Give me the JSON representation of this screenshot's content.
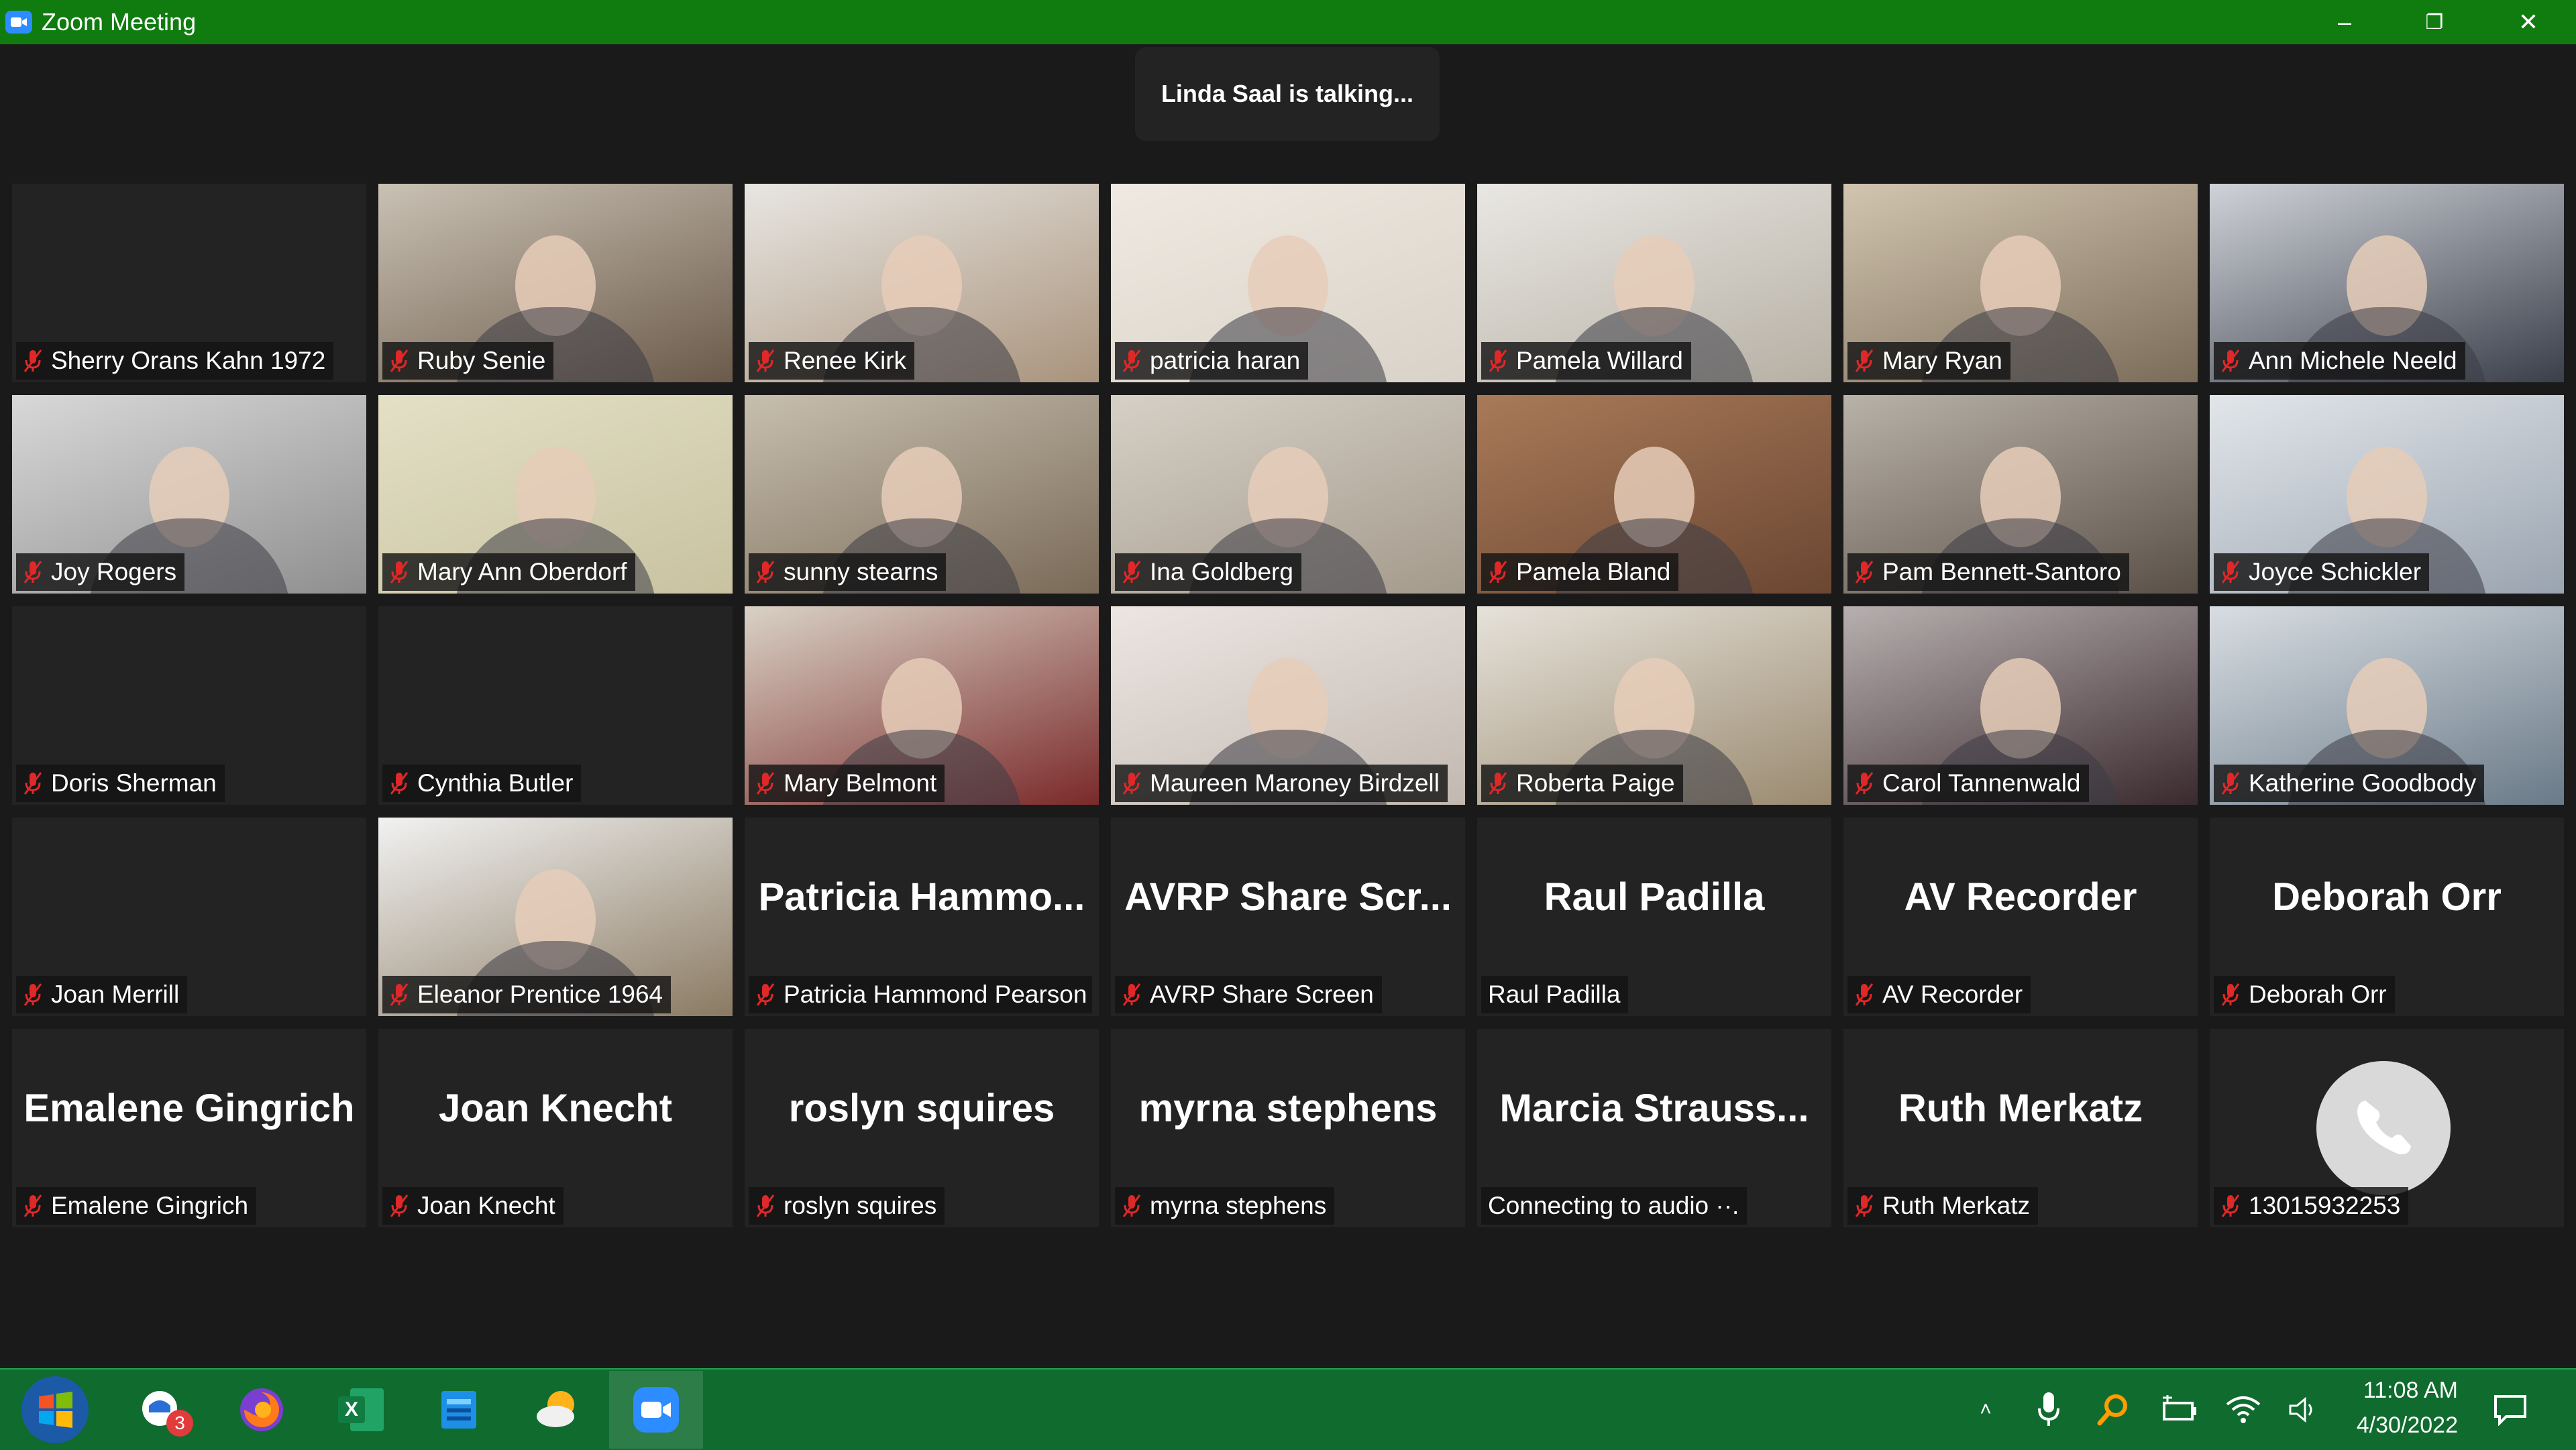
{
  "window": {
    "title": "Zoom Meeting",
    "minimize_glyph": "–",
    "restore_glyph": "❐",
    "close_glyph": "✕"
  },
  "talking_banner": "Linda Saal is talking...",
  "colors": {
    "titlebar": "#107c10",
    "tile_bg": "#232323",
    "muted_mic": "#e02828",
    "taskbar": "#0f6b2e"
  },
  "participants": [
    {
      "name": "Sherry Orans Kahn 1972",
      "muted": true
    },
    {
      "name": "Ruby Senie",
      "muted": true
    },
    {
      "name": "Renee Kirk",
      "muted": true
    },
    {
      "name": "patricia haran",
      "muted": true
    },
    {
      "name": "Pamela Willard",
      "muted": true
    },
    {
      "name": "Mary Ryan",
      "muted": true
    },
    {
      "name": "Ann Michele Neeld",
      "muted": true
    },
    {
      "name": "Joy Rogers",
      "muted": true
    },
    {
      "name": "Mary Ann Oberdorf",
      "muted": true
    },
    {
      "name": "sunny stearns",
      "muted": true
    },
    {
      "name": "Ina Goldberg",
      "muted": true
    },
    {
      "name": "Pamela Bland",
      "muted": true
    },
    {
      "name": "Pam Bennett-Santoro",
      "muted": true
    },
    {
      "name": "Joyce Schickler",
      "muted": true
    },
    {
      "name": "Doris Sherman",
      "muted": true
    },
    {
      "name": "Cynthia Butler",
      "muted": true
    },
    {
      "name": "Mary Belmont",
      "muted": true
    },
    {
      "name": "Maureen Maroney Birdzell",
      "muted": true
    },
    {
      "name": "Roberta Paige",
      "muted": true
    },
    {
      "name": "Carol Tannenwald",
      "muted": true
    },
    {
      "name": "Katherine Goodbody",
      "muted": true
    },
    {
      "name": "Joan Merrill",
      "muted": true
    },
    {
      "name": "Eleanor Prentice 1964",
      "muted": true
    },
    {
      "name": "Patricia Hammond Pearson",
      "display": "Patricia  Hammo...",
      "muted": true
    },
    {
      "name": "AVRP Share Screen",
      "display": "AVRP  Share  Scr...",
      "muted": true
    },
    {
      "name": "Raul Padilla",
      "display": "Raul Padilla",
      "muted": false
    },
    {
      "name": "AV Recorder",
      "display": "AV Recorder",
      "muted": true
    },
    {
      "name": "Deborah Orr",
      "display": "Deborah Orr",
      "muted": true
    },
    {
      "name": "Emalene Gingrich",
      "display": "Emalene Gingrich",
      "muted": true
    },
    {
      "name": "Joan Knecht",
      "display": "Joan Knecht",
      "muted": true
    },
    {
      "name": "roslyn squires",
      "display": "roslyn squires",
      "muted": true
    },
    {
      "name": "myrna stephens",
      "display": "myrna stephens",
      "muted": true
    },
    {
      "name": "Connecting to audio ··.",
      "display": "Marcia  Strauss...",
      "muted": false
    },
    {
      "name": "Ruth Merkatz",
      "display": "Ruth Merkatz",
      "muted": true
    },
    {
      "name": "13015932253",
      "phone": true,
      "muted": true
    }
  ],
  "taskbar": {
    "mail_badge": "3",
    "clock_time": "11:08 AM",
    "clock_date": "4/30/2022",
    "tray_chevron": "˄",
    "excel_letter": "X"
  }
}
